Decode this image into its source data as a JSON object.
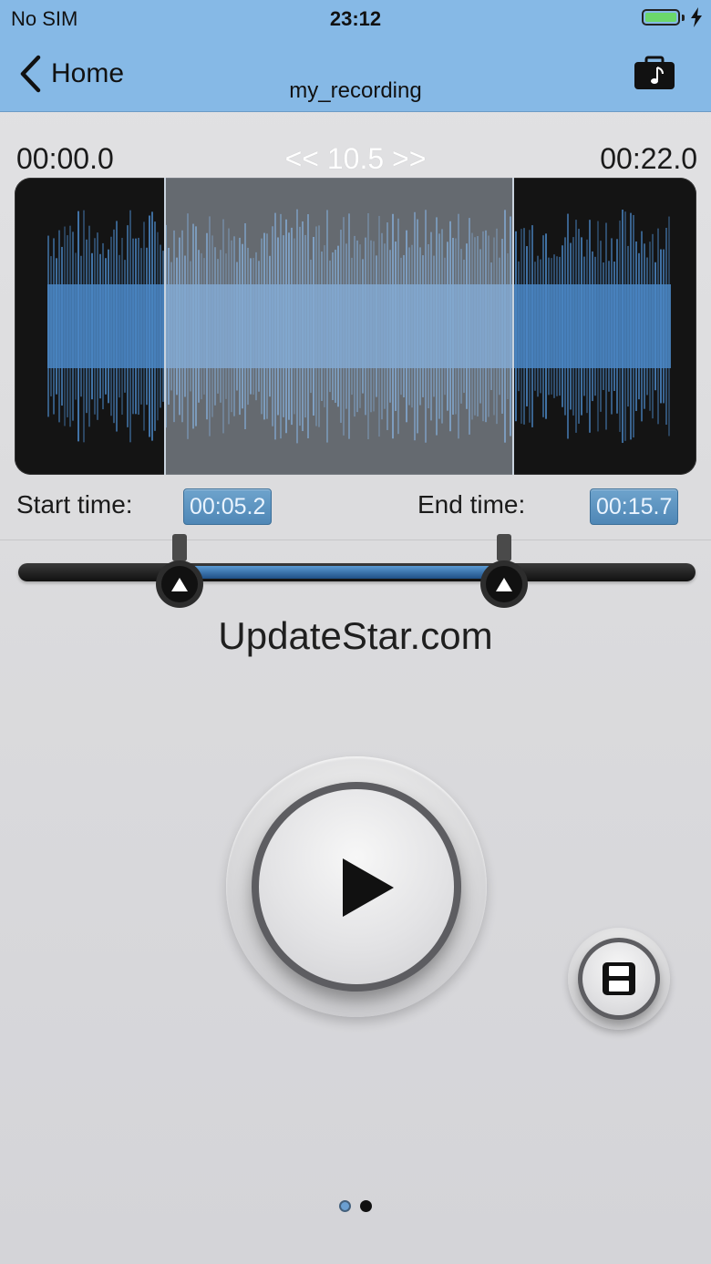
{
  "status_bar": {
    "carrier": "No SIM",
    "time": "23:12",
    "battery_color": "#6bd76b"
  },
  "nav": {
    "back_label": "Home",
    "title": "my_recording",
    "back_icon": "chevron-left-icon",
    "share_icon": "music-case-icon"
  },
  "timeline": {
    "start": "00:00.0",
    "duration": "<< 10.5 >>",
    "end": "00:22.0"
  },
  "trim": {
    "start_label": "Start time:",
    "start_value": "00:05.2",
    "end_label": "End time:",
    "end_value": "00:15.7",
    "total_seconds": 22.0,
    "start_seconds": 5.2,
    "end_seconds": 15.7
  },
  "watermark": "UpdateStar.com",
  "controls": {
    "play_icon": "play-icon",
    "save_icon": "floppy-disk-icon"
  },
  "pager": {
    "count": 2,
    "active": 0
  },
  "colors": {
    "header": "#86b9e6",
    "accent": "#5a9ad3",
    "waveform": "#4a86c4"
  }
}
